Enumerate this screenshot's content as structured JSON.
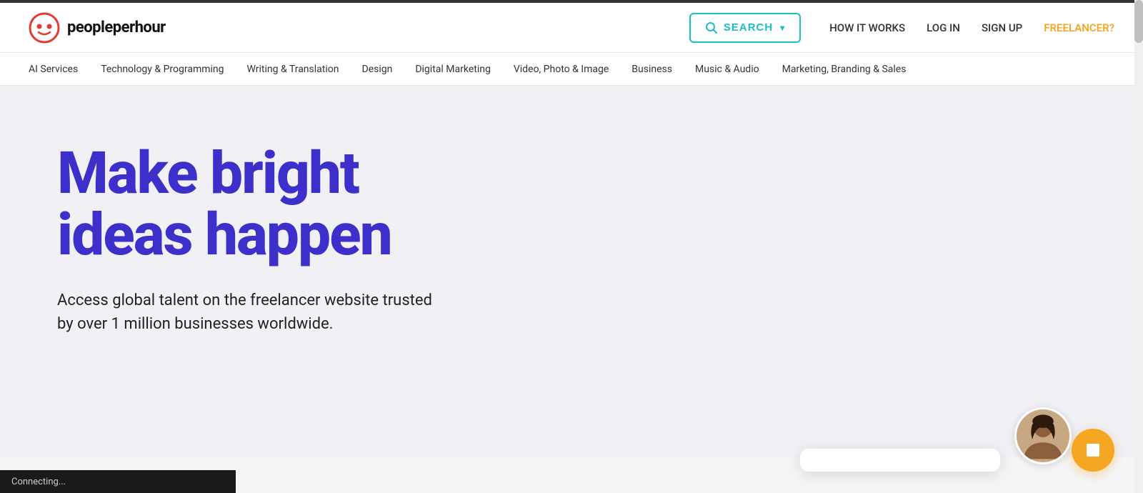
{
  "topBorder": {},
  "header": {
    "logo": {
      "text_people": "people",
      "text_per": "per",
      "text_hour": "hour"
    },
    "search": {
      "label": "SEARCH",
      "chevron": "▾"
    },
    "nav": {
      "how_it_works": "HOW IT WORKS",
      "log_in": "LOG IN",
      "sign_up": "SIGN UP",
      "freelancer": "FREELANCER?"
    }
  },
  "categoryNav": {
    "items": [
      "AI Services",
      "Technology & Programming",
      "Writing & Translation",
      "Design",
      "Digital Marketing",
      "Video, Photo & Image",
      "Business",
      "Music & Audio",
      "Marketing, Branding & Sales"
    ]
  },
  "hero": {
    "title_line1": "Make bright",
    "title_line2": "ideas happen",
    "subtitle": "Access global talent on the freelancer website trusted by over 1 million businesses worldwide."
  },
  "footer": {
    "connecting_text": "Connecting..."
  },
  "chat": {
    "button_icon": "□"
  }
}
